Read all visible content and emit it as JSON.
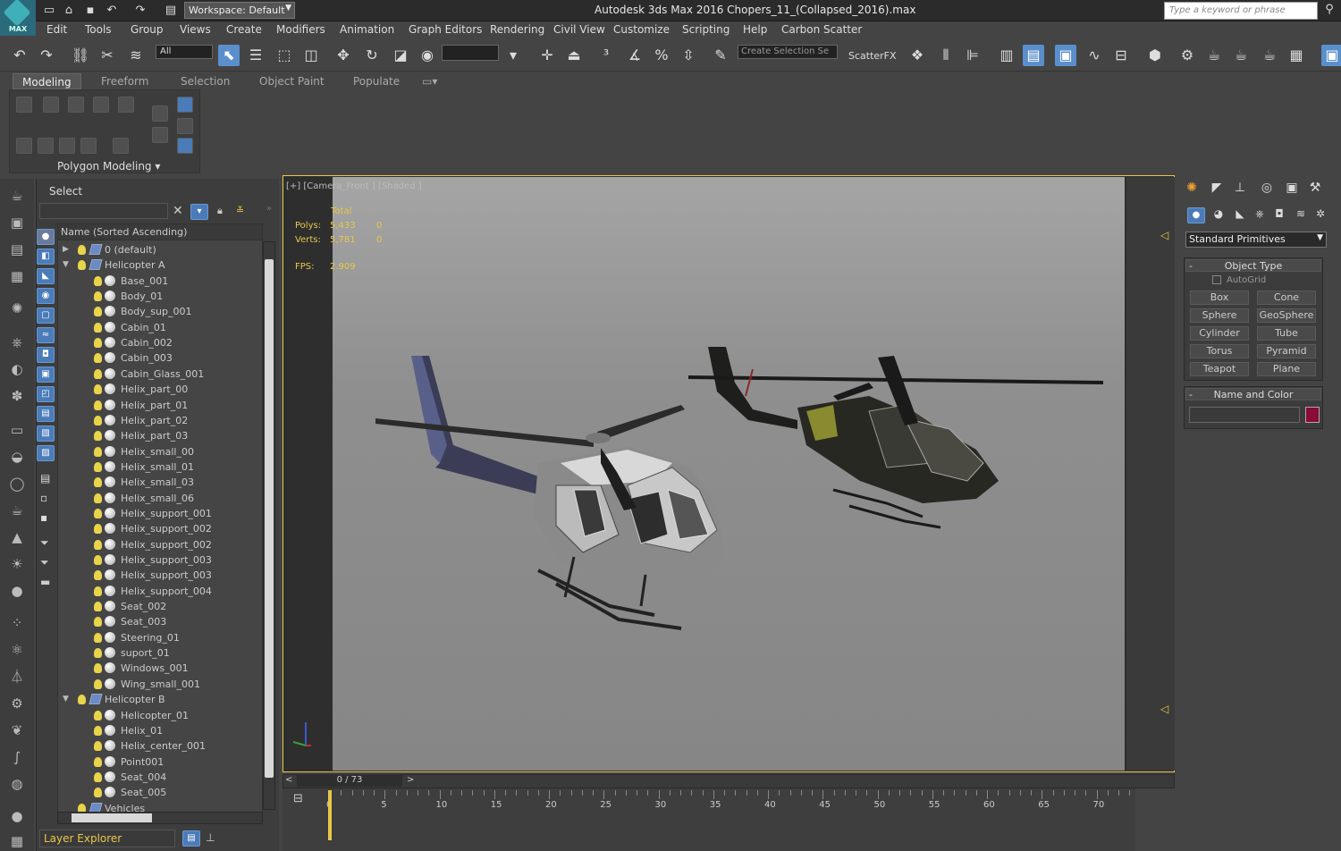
{
  "app": {
    "title": "Autodesk 3ds Max 2016    Chopers_11_(Collapsed_2016).max",
    "logo_text": "MAX"
  },
  "workspace": {
    "value": "Workspace: Default"
  },
  "search": {
    "placeholder": "Type a keyword or phrase"
  },
  "menu": [
    "Edit",
    "Tools",
    "Group",
    "Views",
    "Create",
    "Modifiers",
    "Animation",
    "Graph Editors",
    "Rendering",
    "Civil View",
    "Customize",
    "Scripting",
    "Help",
    "Carbon Scatter"
  ],
  "toolbar": {
    "selection_filter": "All",
    "named_selection": "Create Selection Se",
    "scatterfx": "ScatterFX"
  },
  "ribbon": {
    "tabs": [
      "Modeling",
      "Freeform",
      "Selection",
      "Object Paint",
      "Populate"
    ],
    "panel_label": "Polygon Modeling"
  },
  "scene": {
    "select_label": "Select",
    "header": "Name (Sorted Ascending)",
    "layer_explorer": "Layer Explorer",
    "rows": [
      {
        "label": "0 (default)",
        "type": "layer",
        "depth": 0,
        "expand": "closed"
      },
      {
        "label": "Helicopter A",
        "type": "layer",
        "depth": 0,
        "expand": "open"
      },
      {
        "label": "Base_001",
        "type": "obj",
        "depth": 1
      },
      {
        "label": "Body_01",
        "type": "obj",
        "depth": 1
      },
      {
        "label": "Body_sup_001",
        "type": "obj",
        "depth": 1
      },
      {
        "label": "Cabin_01",
        "type": "obj",
        "depth": 1
      },
      {
        "label": "Cabin_002",
        "type": "obj",
        "depth": 1
      },
      {
        "label": "Cabin_003",
        "type": "obj",
        "depth": 1
      },
      {
        "label": "Cabin_Glass_001",
        "type": "obj",
        "depth": 1
      },
      {
        "label": "Helix_part_00",
        "type": "obj",
        "depth": 1
      },
      {
        "label": "Helix_part_01",
        "type": "obj",
        "depth": 1
      },
      {
        "label": "Helix_part_02",
        "type": "obj",
        "depth": 1
      },
      {
        "label": "Helix_part_03",
        "type": "obj",
        "depth": 1
      },
      {
        "label": "Helix_small_00",
        "type": "obj",
        "depth": 1
      },
      {
        "label": "Helix_small_01",
        "type": "obj",
        "depth": 1
      },
      {
        "label": "Helix_small_03",
        "type": "obj",
        "depth": 1
      },
      {
        "label": "Helix_small_06",
        "type": "obj",
        "depth": 1
      },
      {
        "label": "Helix_support_001",
        "type": "obj",
        "depth": 1
      },
      {
        "label": "Helix_support_002",
        "type": "obj",
        "depth": 1
      },
      {
        "label": "Helix_support_002",
        "type": "obj",
        "depth": 1
      },
      {
        "label": "Helix_support_003",
        "type": "obj",
        "depth": 1
      },
      {
        "label": "Helix_support_003",
        "type": "obj",
        "depth": 1
      },
      {
        "label": "Helix_support_004",
        "type": "obj",
        "depth": 1
      },
      {
        "label": "Seat_002",
        "type": "obj",
        "depth": 1
      },
      {
        "label": "Seat_003",
        "type": "obj",
        "depth": 1
      },
      {
        "label": "Steering_01",
        "type": "obj",
        "depth": 1
      },
      {
        "label": "suport_01",
        "type": "obj",
        "depth": 1
      },
      {
        "label": "Windows_001",
        "type": "obj",
        "depth": 1
      },
      {
        "label": "Wing_small_001",
        "type": "obj",
        "depth": 1
      },
      {
        "label": "Helicopter B",
        "type": "layer",
        "depth": 0,
        "expand": "open"
      },
      {
        "label": "Helicopter_01",
        "type": "obj",
        "depth": 1
      },
      {
        "label": "Helix_01",
        "type": "obj",
        "depth": 1
      },
      {
        "label": "Helix_center_001",
        "type": "obj",
        "depth": 1
      },
      {
        "label": "Point001",
        "type": "helper",
        "depth": 1
      },
      {
        "label": "Seat_004",
        "type": "obj",
        "depth": 1
      },
      {
        "label": "Seat_005",
        "type": "obj",
        "depth": 1
      },
      {
        "label": "Vehicles",
        "type": "layer",
        "depth": 0,
        "expand": "none"
      }
    ]
  },
  "viewport": {
    "label": "[+] [Camera_Front ] [Shaded ]",
    "stats": {
      "total_label": "Total",
      "polys_label": "Polys:",
      "polys": "5,433",
      "polys_sel": "0",
      "verts_label": "Verts:",
      "verts": "5,781",
      "verts_sel": "0",
      "fps_label": "FPS:",
      "fps": "2.909"
    }
  },
  "command_panel": {
    "dropdown": "Standard Primitives",
    "object_type_title": "Object Type",
    "autogrid": "AutoGrid",
    "primitives": [
      "Box",
      "Cone",
      "Sphere",
      "GeoSphere",
      "Cylinder",
      "Tube",
      "Torus",
      "Pyramid",
      "Teapot",
      "Plane"
    ],
    "name_color_title": "Name and Color",
    "swatch_color": "#8a0a3a"
  },
  "timeline": {
    "frame": "0 / 73",
    "ticks": [
      "0",
      "5",
      "10",
      "15",
      "20",
      "25",
      "30",
      "35",
      "40",
      "45",
      "50",
      "55",
      "60",
      "65",
      "70"
    ]
  },
  "colors": {
    "accent": "#e8c84a",
    "active_tool": "#5a8fcc"
  }
}
